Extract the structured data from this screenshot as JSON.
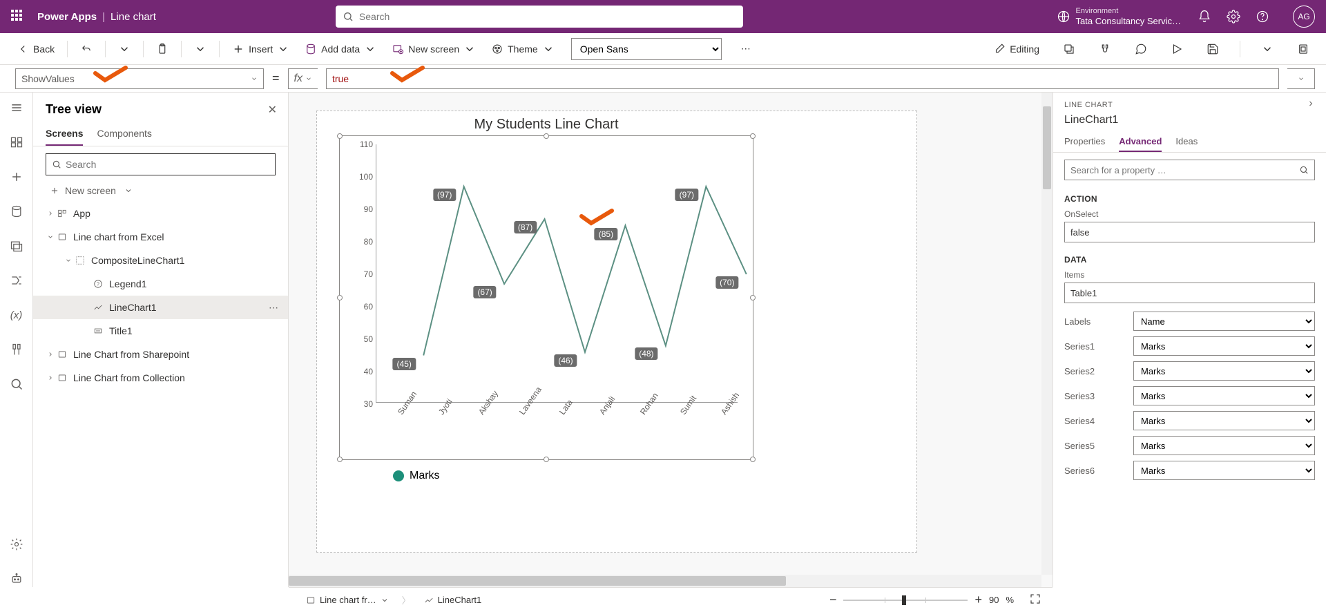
{
  "topbar": {
    "brand": "Power Apps",
    "page": "Line chart",
    "search_placeholder": "Search",
    "env_label": "Environment",
    "env_value": "Tata Consultancy Servic…",
    "avatar": "AG"
  },
  "cmdbar": {
    "back": "Back",
    "insert": "Insert",
    "add_data": "Add data",
    "new_screen": "New screen",
    "theme": "Theme",
    "font": "Open Sans",
    "editing": "Editing"
  },
  "formula": {
    "property": "ShowValues",
    "value": "true"
  },
  "tree": {
    "title": "Tree view",
    "tab_screens": "Screens",
    "tab_components": "Components",
    "search_placeholder": "Search",
    "new_screen": "New screen",
    "nodes": {
      "app": "App",
      "s1": "Line chart from Excel",
      "s1c": "CompositeLineChart1",
      "s1c_legend": "Legend1",
      "s1c_line": "LineChart1",
      "s1c_title": "Title1",
      "s2": "Line Chart from Sharepoint",
      "s3": "Line Chart from Collection"
    }
  },
  "chart_data": {
    "type": "line",
    "title": "My Students Line Chart",
    "categories": [
      "Suman",
      "Jyoti",
      "Akshay",
      "Laveena",
      "Lata",
      "Anjali",
      "Rohan",
      "Sumit",
      "Ashish"
    ],
    "series": [
      {
        "name": "Marks",
        "values": [
          45,
          97,
          67,
          87,
          46,
          85,
          48,
          97,
          70
        ]
      }
    ],
    "ylim": [
      30,
      110
    ],
    "yticks": [
      30,
      40,
      50,
      60,
      70,
      80,
      90,
      100,
      110
    ],
    "legend": "Marks"
  },
  "props": {
    "type_label": "LINE CHART",
    "name": "LineChart1",
    "tab_properties": "Properties",
    "tab_advanced": "Advanced",
    "tab_ideas": "Ideas",
    "search_placeholder": "Search for a property …",
    "section_action": "ACTION",
    "onselect_label": "OnSelect",
    "onselect_value": "false",
    "section_data": "DATA",
    "items_label": "Items",
    "items_value": "Table1",
    "labels_label": "Labels",
    "labels_value": "Name",
    "series1_label": "Series1",
    "series2_label": "Series2",
    "series3_label": "Series3",
    "series4_label": "Series4",
    "series5_label": "Series5",
    "series6_label": "Series6",
    "series_value": "Marks"
  },
  "status": {
    "screen": "Line chart fr…",
    "control": "LineChart1",
    "zoom": "90",
    "zoom_unit": "%"
  }
}
